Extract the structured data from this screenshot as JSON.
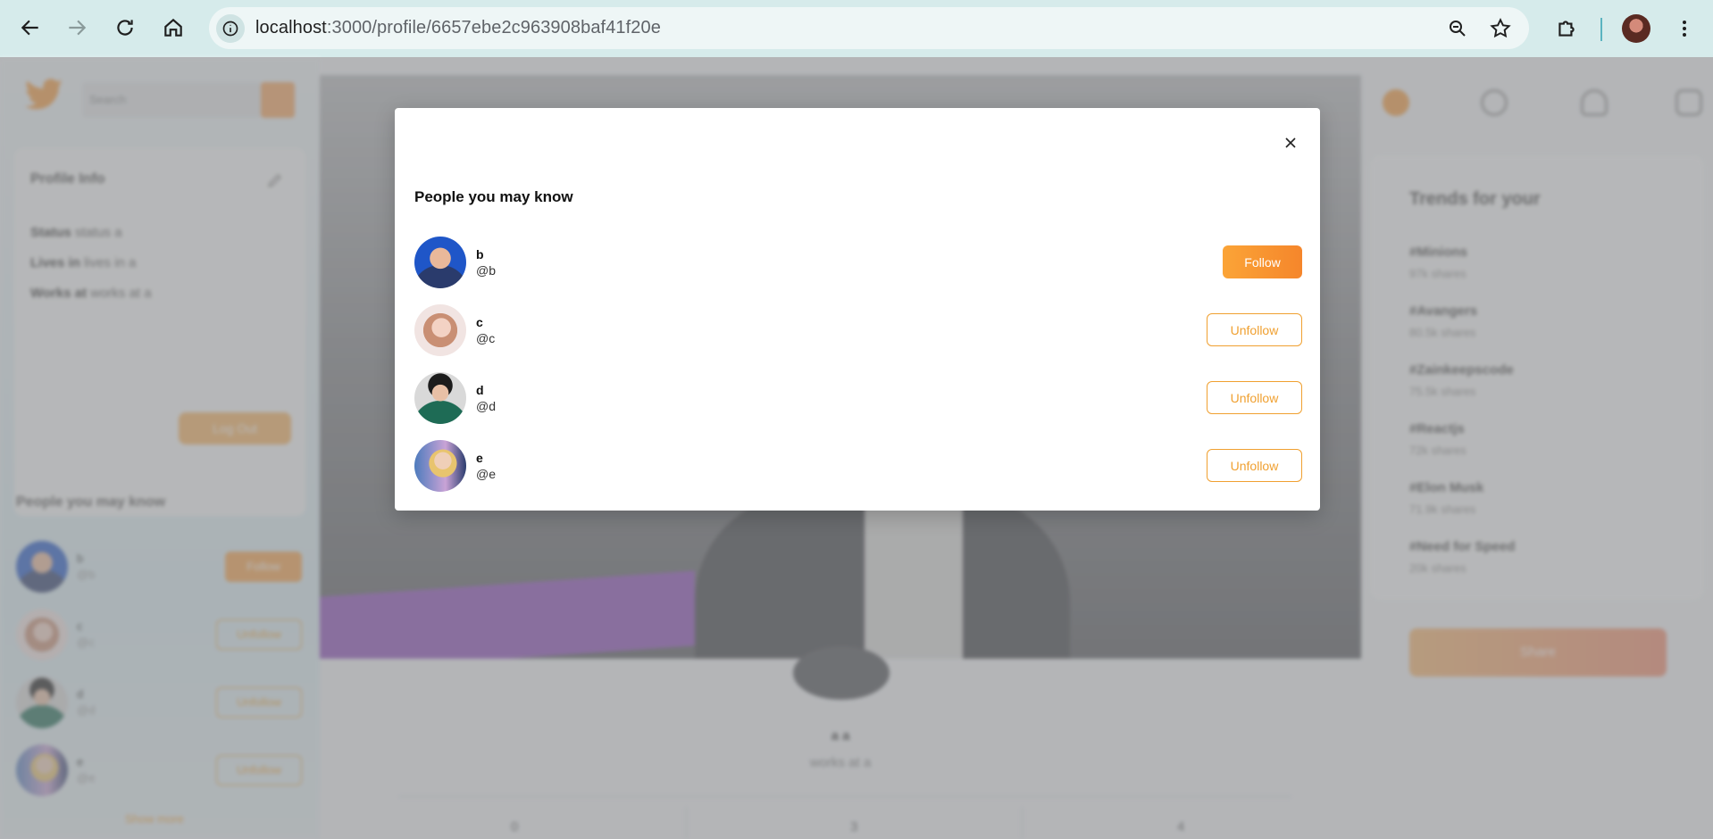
{
  "browser": {
    "url_host": "localhost",
    "url_path": ":3000/profile/6657ebe2c963908baf41f20e",
    "back_icon": "arrow-left-icon",
    "forward_icon": "arrow-right-icon",
    "reload_icon": "reload-icon",
    "home_icon": "home-icon",
    "site_info_icon": "info-icon",
    "zoom_icon": "zoom-icon",
    "bookmark_icon": "star-icon",
    "extensions_icon": "puzzle-icon",
    "menu_icon": "kebab-menu-icon"
  },
  "app": {
    "search_placeholder": "Search",
    "profile_info": {
      "title": "Profile Info",
      "rows": [
        {
          "label": "Status",
          "value": "status a"
        },
        {
          "label": "Lives in",
          "value": "lives in a"
        },
        {
          "label": "Works at",
          "value": "works at a"
        }
      ],
      "logout_label": "Log Out"
    },
    "sidebar_suggestions": {
      "title": "People you may know",
      "people": [
        {
          "name": "b",
          "handle": "@b",
          "action": "Follow"
        },
        {
          "name": "c",
          "handle": "@c",
          "action": "Unfollow"
        },
        {
          "name": "d",
          "handle": "@d",
          "action": "Unfollow"
        },
        {
          "name": "e",
          "handle": "@e",
          "action": "Unfollow"
        }
      ],
      "show_more": "Show more"
    },
    "profile": {
      "name": "a a",
      "subtitle": "works at a",
      "stats": [
        "0",
        "3",
        "4"
      ]
    },
    "trends": {
      "title": "Trends for your",
      "items": [
        {
          "tag": "#Minions",
          "count": "97k shares"
        },
        {
          "tag": "#Avangers",
          "count": "80.5k shares"
        },
        {
          "tag": "#Zainkeepscode",
          "count": "75.5k shares"
        },
        {
          "tag": "#Reactjs",
          "count": "72k shares"
        },
        {
          "tag": "#Elon Musk",
          "count": "71.9k shares"
        },
        {
          "tag": "#Need for Speed",
          "count": "20k shares"
        }
      ],
      "share_label": "Share"
    }
  },
  "modal": {
    "title": "People you may know",
    "close_icon": "close-icon",
    "people": [
      {
        "name": "b",
        "handle": "@b",
        "action": "Follow"
      },
      {
        "name": "c",
        "handle": "@c",
        "action": "Unfollow"
      },
      {
        "name": "d",
        "handle": "@d",
        "action": "Unfollow"
      },
      {
        "name": "e",
        "handle": "@e",
        "action": "Unfollow"
      }
    ]
  },
  "colors": {
    "accent": "#f5862b",
    "accent_outline": "#f0a030",
    "chrome_bg": "#d6ebeb"
  }
}
